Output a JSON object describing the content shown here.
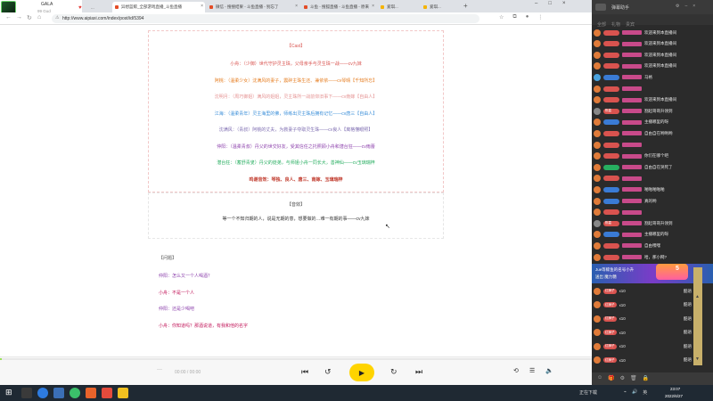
{
  "streamer": {
    "name": "GALA",
    "subtitle": "99 Gud"
  },
  "tabs": [
    {
      "label": "...",
      "active": false
    },
    {
      "label": "异想蓝鲸_全部游戏直播_斗鱼直播",
      "active": true
    },
    {
      "label": "微信 - 搜搜结果 - 斗鱼直播 - 别忘了",
      "active": false
    },
    {
      "label": "斗鱼 - 搜狐直播 - 斗鱼直播 - 原来",
      "active": false
    },
    {
      "label": "爱琪...",
      "active": false
    },
    {
      "label": "爱琪...",
      "active": false
    }
  ],
  "address": {
    "url": "http://www.aipiaxi.com/index/post/id/5394"
  },
  "script": {
    "cast_heading": "【Cast】",
    "cast_lines": [
      {
        "text": "小舟：（少御）世代守护灵主珠，父母亲手与灵生珠一战——cv九妹",
        "color": "#d9534f"
      },
      {
        "text": "阿桃：（温柔少女）沈满风的妻子，震碎主珠生还、兼依依——cv琴晴【千知所忘】",
        "color": "#e67e22"
      },
      {
        "text": "沈明月：（周巧御姐）满风的姐姐，灵主珠所一战前仰旧事下——cv南嫁【自由人】",
        "color": "#e59393"
      },
      {
        "text": "江海：（温柔青年）灵主海里的佛，师练出灵主珠后拥有记忆——cv唐三【自由人】",
        "color": "#3b8fd9"
      },
      {
        "text": "沈满风：（青叔）阿桃的丈夫，为救妻子夺取灵生珠——cv良人【离格懂眼照】",
        "color": "#7c6bb0"
      },
      {
        "text": "仲阳：（温柔青叔）丹父的世交好友，受其信任之托照顾小舟和潜台狂——cv雨蕾",
        "color": "#8e44ad"
      },
      {
        "text": "潜台狂：（蓄舒青叟）丹父的徒弟，与师姐小舟一同长大，善神仙——cv玉璃瑞梓",
        "color": "#27ae60"
      },
      {
        "text": "鸣谢音效：琴独、良人、唐三、南嫁、玉璃瑞梓",
        "color": "#c0392b",
        "bold": true
      }
    ],
    "sfx_heading": "【音效】",
    "sfx_line": "等一个不知归期的人，说是无期的意，想要做的…难一有期的事——cv九妹",
    "dialog_heading": "【问题】",
    "dialog": [
      {
        "speaker": "仲阳：",
        "text": "怎么又一个人喝酒？",
        "color": "#8e44ad"
      },
      {
        "speaker": "小舟：",
        "text": "不是一个人",
        "color": "#c2185b"
      },
      {
        "speaker": "仲阳：",
        "text": "还是少喝吧",
        "color": "#8e44ad"
      },
      {
        "speaker": "小舟：",
        "text": "你知道吗？那酒说道，有我和他的名字",
        "color": "#c2185b"
      }
    ]
  },
  "player": {
    "time": "00:00 / 00:00",
    "progress": 0.0,
    "dash": "---"
  },
  "chat": {
    "title": "弹幕助手",
    "toolbar_items": [
      "全部",
      "礼物",
      "贵宾"
    ],
    "messages": [
      {
        "text": "欢迎来到本直播间",
        "badge": "",
        "badge_color": "#d9534f",
        "av_color": "#e07b39"
      },
      {
        "text": "欢迎来到本直播间",
        "badge": "",
        "badge_color": "#d9534f",
        "av_color": "#e07b39"
      },
      {
        "text": "欢迎来到本直播间",
        "badge": "",
        "badge_color": "#d9534f",
        "av_color": "#e07b39"
      },
      {
        "text": "欢迎来到本直播间",
        "badge": "",
        "badge_color": "#d9534f",
        "av_color": "#e07b39"
      },
      {
        "text": "马格",
        "badge": "",
        "badge_color": "#3a7bd5",
        "av_color": "#4aa3df"
      },
      {
        "text": "",
        "badge": "",
        "badge_color": "#d9534f",
        "av_color": "#e07b39"
      },
      {
        "text": "欢迎来到本直播间",
        "badge": "",
        "badge_color": "#d9534f",
        "av_color": "#e07b39"
      },
      {
        "text": "割起哥哥升领到",
        "badge": "陈嘉",
        "badge_color": "#d9534f",
        "av_color": "#888"
      },
      {
        "text": "主播哪里的呀",
        "badge": "",
        "badge_color": "#3a7bd5",
        "av_color": "#e07b39"
      },
      {
        "text": "自由自在哟哟哟",
        "badge": "",
        "badge_color": "#d9534f",
        "av_color": "#e07b39"
      },
      {
        "text": "",
        "badge": "",
        "badge_color": "#d9534f",
        "av_color": "#e07b39"
      },
      {
        "text": "你们在哪个吧",
        "badge": "",
        "badge_color": "#d9534f",
        "av_color": "#e07b39"
      },
      {
        "text": "自由自在哭死了",
        "badge": "",
        "badge_color": "#27ae60",
        "av_color": "#e07b39"
      },
      {
        "text": "",
        "badge": "",
        "badge_color": "#d9534f",
        "av_color": "#e07b39"
      },
      {
        "text": "啪啪啪啪啪",
        "badge": "",
        "badge_color": "#3a7bd5",
        "av_color": "#e07b39"
      },
      {
        "text": "真的哟",
        "badge": "",
        "badge_color": "#3a7bd5",
        "av_color": "#e07b39"
      },
      {
        "text": "",
        "badge": "",
        "badge_color": "#d9534f",
        "av_color": "#e07b39"
      },
      {
        "text": "割起哥哥升领到",
        "badge": "陈嘉",
        "badge_color": "#d9534f",
        "av_color": "#888"
      },
      {
        "text": "主播哪里的呀",
        "badge": "",
        "badge_color": "#3a7bd5",
        "av_color": "#e07b39"
      },
      {
        "text": "自由嘿嘿",
        "badge": "",
        "badge_color": "#d9534f",
        "av_color": "#e07b39"
      },
      {
        "text": "哈，那小网?",
        "badge": "",
        "badge_color": "#d9534f",
        "av_color": "#e07b39"
      }
    ],
    "gift_banner": {
      "line1": "Jue等鲸鱼的名号小升",
      "line2": "送出  魔力糖",
      "level": "5"
    },
    "gift_rows": [
      {
        "label": "x10",
        "badge": "红狮子",
        "right": "酷语"
      },
      {
        "label": "x10",
        "badge": "红狮子",
        "right": "酷语"
      },
      {
        "label": "x10",
        "badge": "红狮子",
        "right": "酷语"
      },
      {
        "label": "x10",
        "badge": "红狮子",
        "right": "酷语"
      },
      {
        "label": "x10",
        "badge": "红狮子",
        "right": "酷语"
      },
      {
        "label": "x10",
        "badge": "红狮子",
        "right": "酷语"
      }
    ]
  },
  "taskbar": {
    "tray_text": "正在下载",
    "tray_input": "英",
    "time": "23:07",
    "date": "2022/6/27"
  }
}
